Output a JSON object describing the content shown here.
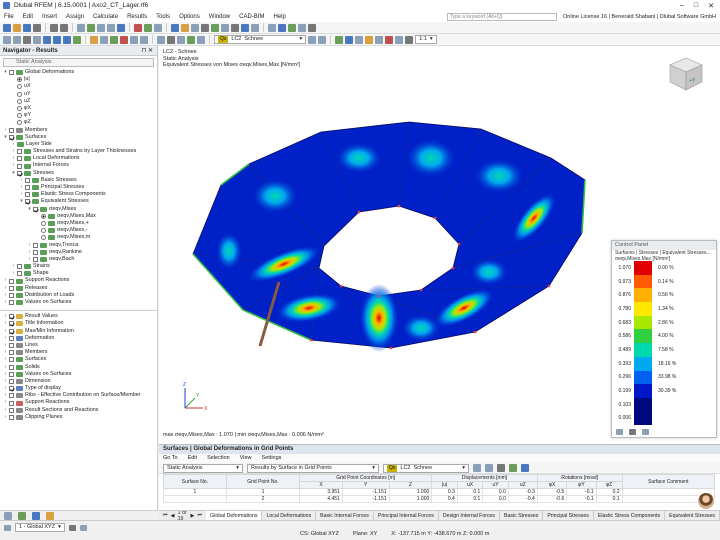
{
  "app": {
    "title": "Dlubal RFEM | 6.15.0001 | Axo2_CT_Lager.rf6"
  },
  "menu": {
    "items": [
      "File",
      "Edit",
      "Insert",
      "Assign",
      "Calculate",
      "Results",
      "Tools",
      "Options",
      "Window",
      "CAD-BIM",
      "Help"
    ],
    "search_placeholder": "Type a keyword (Alt+Q)",
    "license": "Online License 16 | Benerald Shabani | Dlubal Software GmbH"
  },
  "toolbar": {
    "lc_badge": "Qs",
    "lc": "LC2",
    "lc_name": "Schnee",
    "scale": "1:1"
  },
  "navigator": {
    "title": "Navigator - Results",
    "combo": "Static Analysis",
    "tree": [
      {
        "indent": 0,
        "type": "cb",
        "label": "Global Deformations",
        "icon": "g",
        "toggle": "▾"
      },
      {
        "indent": 1,
        "type": "rd",
        "on": true,
        "label": "|u|"
      },
      {
        "indent": 1,
        "type": "rd",
        "label": "uX"
      },
      {
        "indent": 1,
        "type": "rd",
        "label": "uY"
      },
      {
        "indent": 1,
        "type": "rd",
        "label": "uZ"
      },
      {
        "indent": 1,
        "type": "rd",
        "label": "φX"
      },
      {
        "indent": 1,
        "type": "rd",
        "label": "φY"
      },
      {
        "indent": 1,
        "type": "rd",
        "label": "φZ"
      },
      {
        "indent": 0,
        "type": "cb",
        "label": "Members",
        "icon": "gy",
        "toggle": "›"
      },
      {
        "indent": 0,
        "type": "cb",
        "on": true,
        "label": "Surfaces",
        "icon": "g",
        "toggle": "▾"
      },
      {
        "indent": 1,
        "type": "none",
        "label": "Layer Side",
        "icon": "g",
        "toggle": "›"
      },
      {
        "indent": 1,
        "type": "cb",
        "label": "Stresses and Strains by Layer Thicknesses",
        "icon": "g",
        "toggle": "›"
      },
      {
        "indent": 1,
        "type": "cb",
        "label": "Local Deformations",
        "icon": "g",
        "toggle": "›"
      },
      {
        "indent": 1,
        "type": "cb",
        "label": "Internal Forces",
        "icon": "g",
        "toggle": "›"
      },
      {
        "indent": 1,
        "type": "cb",
        "on": true,
        "label": "Stresses",
        "icon": "g",
        "toggle": "▾"
      },
      {
        "indent": 2,
        "type": "cb",
        "label": "Basic Stresses",
        "icon": "g",
        "toggle": "›"
      },
      {
        "indent": 2,
        "type": "cb",
        "label": "Principal Stresses",
        "icon": "g",
        "toggle": "›"
      },
      {
        "indent": 2,
        "type": "cb",
        "label": "Elastic Stress Components",
        "icon": "g",
        "toggle": "›"
      },
      {
        "indent": 2,
        "type": "cb",
        "on": true,
        "label": "Equivalent Stresses",
        "icon": "g",
        "toggle": "▾"
      },
      {
        "indent": 3,
        "type": "cb",
        "on": true,
        "label": "σeqv,Mises",
        "icon": "g",
        "toggle": "▾"
      },
      {
        "indent": 4,
        "type": "rd",
        "on": true,
        "label": "σeqv,Mises,Max",
        "icon": "g"
      },
      {
        "indent": 4,
        "type": "rd",
        "label": "σeqv,Mises,+",
        "icon": "g"
      },
      {
        "indent": 4,
        "type": "rd",
        "label": "σeqv,Mises,-",
        "icon": "g"
      },
      {
        "indent": 4,
        "type": "rd",
        "label": "σeqv,Mises,m",
        "icon": "g"
      },
      {
        "indent": 3,
        "type": "cb",
        "label": "σeqv,Tresca",
        "icon": "g",
        "toggle": "›"
      },
      {
        "indent": 3,
        "type": "cb",
        "label": "σeqv,Rankine",
        "icon": "g",
        "toggle": "›"
      },
      {
        "indent": 3,
        "type": "cb",
        "label": "σeqv,Bach",
        "icon": "g",
        "toggle": "›"
      },
      {
        "indent": 1,
        "type": "cb",
        "label": "Strains",
        "icon": "g",
        "toggle": "›"
      },
      {
        "indent": 1,
        "type": "cb",
        "label": "Shape",
        "icon": "g",
        "toggle": "›"
      },
      {
        "indent": 0,
        "type": "cb",
        "label": "Support Reactions",
        "icon": "g",
        "toggle": "›"
      },
      {
        "indent": 0,
        "type": "cb",
        "label": "Releases",
        "icon": "g",
        "toggle": "›"
      },
      {
        "indent": 0,
        "type": "cb",
        "label": "Distribution of Loads",
        "icon": "g",
        "toggle": "›"
      },
      {
        "indent": 0,
        "type": "cb",
        "label": "Values on Surfaces",
        "icon": "g",
        "toggle": "›"
      }
    ],
    "tree2": [
      {
        "on": true,
        "label": "Result Values",
        "icon": "y"
      },
      {
        "on": true,
        "label": "Title Information",
        "icon": "y"
      },
      {
        "on": true,
        "label": "Max/Min Information",
        "icon": "y"
      },
      {
        "label": "Deformation",
        "icon": "b"
      },
      {
        "label": "Lines",
        "icon": "gy"
      },
      {
        "label": "Members",
        "icon": "gy"
      },
      {
        "label": "Surfaces",
        "icon": "g"
      },
      {
        "label": "Solids",
        "icon": "g"
      },
      {
        "label": "Values on Surfaces",
        "icon": "g"
      },
      {
        "label": "Dimension",
        "icon": "gy"
      },
      {
        "on": true,
        "label": "Type of display",
        "icon": "b"
      },
      {
        "label": "Ribs - Effective Contribution on Surface/Member",
        "icon": "gy"
      },
      {
        "label": "Support Reactions",
        "icon": "r"
      },
      {
        "label": "Result Sections and Reactions",
        "icon": "gy"
      },
      {
        "label": "Clipping Planes",
        "icon": "gy"
      }
    ]
  },
  "view": {
    "line1": "LC2 - Schnee",
    "line2": "Static Analysis",
    "line3": "Equivalent Stresses von Mises σeqv,Mises,Max [N/mm²]",
    "footer": "max σeqv,Mises,Max : 1.070 | min σeqv,Mises,Max : 0.006 N/mm²"
  },
  "control_panel": {
    "title": "Control Panel",
    "line1": "Surfaces | Stresses | Equivalent Stresses...",
    "line2": "σeqv,Mises,Max [N/mm²]",
    "legend": [
      {
        "value": "1.070",
        "color": "#e00000",
        "pct": "0.00 %"
      },
      {
        "value": "0.973",
        "color": "#ff5a00",
        "pct": "0.14 %"
      },
      {
        "value": "0.876",
        "color": "#ffb000",
        "pct": "0.56 %"
      },
      {
        "value": "0.780",
        "color": "#ffe800",
        "pct": "1.34 %"
      },
      {
        "value": "0.683",
        "color": "#a8e800",
        "pct": "2.86 %"
      },
      {
        "value": "0.586",
        "color": "#30d040",
        "pct": "4.00 %"
      },
      {
        "value": "0.489",
        "color": "#00d8b0",
        "pct": "7.58 %"
      },
      {
        "value": "0.393",
        "color": "#00a8f0",
        "pct": "18.16 %"
      },
      {
        "value": "0.296",
        "color": "#0060f0",
        "pct": "33.98 %"
      },
      {
        "value": "0.199",
        "color": "#0018c8",
        "pct": "30.39 %"
      },
      {
        "value": "0.103",
        "color": "#000880",
        "pct": ""
      },
      {
        "value": "0.006",
        "color": "#000880",
        "pct": ""
      }
    ]
  },
  "results": {
    "title": "Surfaces | Global Deformations in Grid Points",
    "menu": [
      "Go To",
      "Edit",
      "Selection",
      "View",
      "Settings"
    ],
    "analysis": "Static Analysis",
    "result_type": "Results by Surface in Grid Points",
    "lc_badge": "Qs",
    "lc": "LC2",
    "lc_name": "Schnee",
    "groups": [
      "Surface No.",
      "Grid Point No.",
      "Grid Point Coordinates [m]",
      "Displacements [mm]",
      "Rotations [mrad]",
      "Surface Comment"
    ],
    "cols": [
      "X",
      "Y",
      "Z",
      "|u|",
      "uX",
      "uY",
      "uZ",
      "φX",
      "φY",
      "φZ"
    ],
    "rows": [
      [
        "1",
        "1",
        "3.951",
        "-1.151",
        "1.000",
        "0.3",
        "0.1",
        "0.0",
        "-0.3",
        "-0.5",
        "-0.1",
        "0.2"
      ],
      [
        "",
        "2",
        "4.451",
        "-1.151",
        "1.000",
        "0.4",
        "0.1",
        "0.0",
        "-0.4",
        "-0.6",
        "-0.1",
        "0.1"
      ]
    ]
  },
  "tabs": {
    "pager": "1 of 19",
    "items": [
      "Global Deformations",
      "Local Deformations",
      "Basic Internal Forces",
      "Principal Internal Forces",
      "Design Internal Forces",
      "Basic Stresses",
      "Principal Stresses",
      "Elastic Stress Components",
      "Equivalent Stresses"
    ]
  },
  "status": {
    "cs": "1 - Global XYZ",
    "cs2": "CS: Global XYZ",
    "plane": "Plane: XY",
    "coords": "X: -137.715 m   Y: -438.670 m   Z: 0.000 m"
  }
}
